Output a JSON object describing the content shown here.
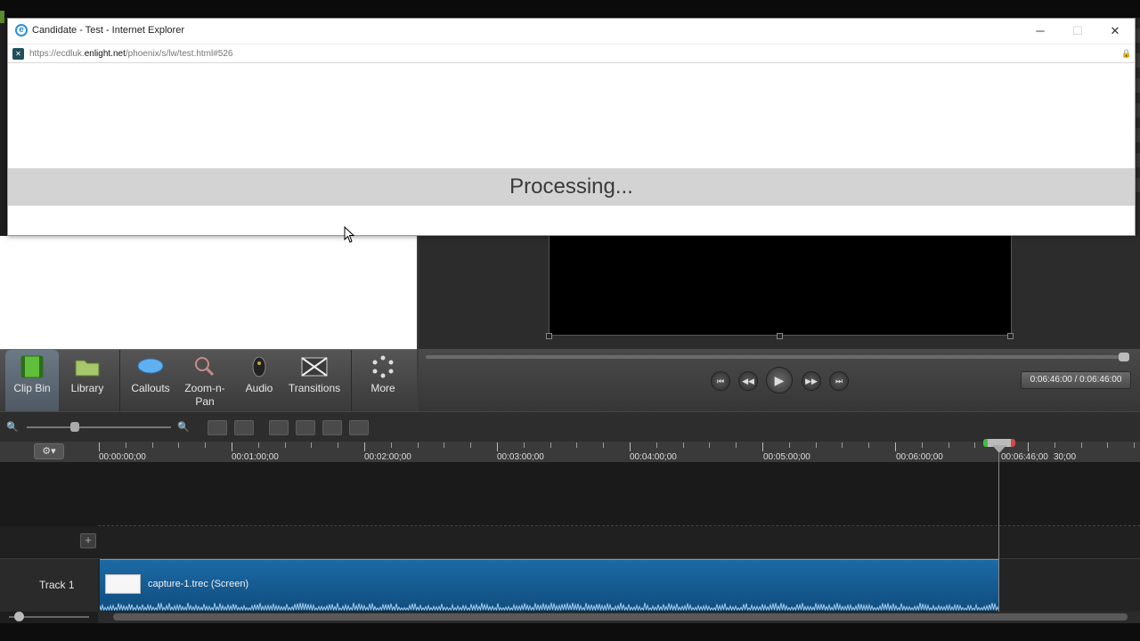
{
  "popup": {
    "title": "Candidate - Test - Internet Explorer",
    "url_prefix": "https://ecdluk.",
    "url_domain": "enlight.net",
    "url_path": "/phoenix/s/lw/test.html#526",
    "processing_text": "Processing...",
    "minimize": "─",
    "maximize": "☐",
    "close": "✕"
  },
  "tools": [
    {
      "label": "Clip Bin",
      "icon": "film-icon",
      "active": true
    },
    {
      "label": "Library",
      "icon": "folder-icon"
    },
    {
      "label": "Callouts",
      "icon": "speech-bubble-icon"
    },
    {
      "label": "Zoom-n-\nPan",
      "icon": "magnifier-icon"
    },
    {
      "label": "Audio",
      "icon": "speaker-icon"
    },
    {
      "label": "Transitions",
      "icon": "transition-icon"
    },
    {
      "label": "More",
      "icon": "more-dots-icon"
    }
  ],
  "player": {
    "time": "0:06:46:00 / 0:06:46:00"
  },
  "ruler": {
    "labels": [
      "00:00:00;00",
      "00:01:00;00",
      "00:02:00;00",
      "00:03:00;00",
      "00:04:00;00",
      "00:05:00;00",
      "00:06:00;00",
      "00:06:46;00",
      "30;00"
    ]
  },
  "timeline": {
    "track_name": "Track 1",
    "clip_name": "capture-1.trec (Screen)"
  },
  "colors": {
    "clip": "#1c6aa6",
    "popup_band": "#d3d3d3"
  }
}
